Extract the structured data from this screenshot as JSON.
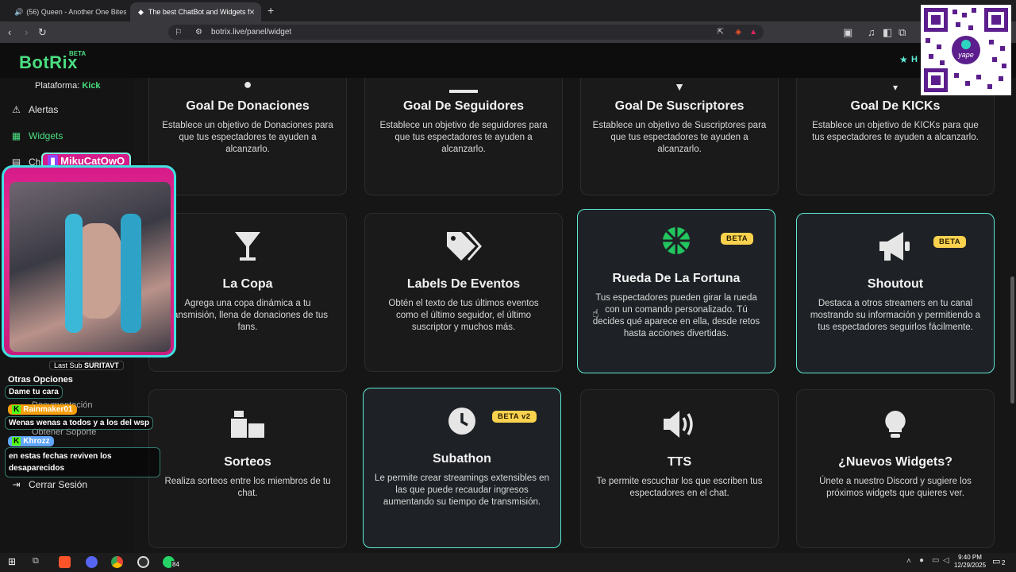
{
  "browser": {
    "tabs": [
      {
        "label": "(56) Queen - Another One Bites t"
      },
      {
        "label": "The best ChatBot and Widgets f"
      }
    ],
    "new_tab": "+",
    "url": "botrix.live/panel/widget"
  },
  "app": {
    "logo": "BotRix",
    "logo_badge": "BETA",
    "platform_label": "Plataforma:",
    "platform_value": "Kick",
    "header_right": "H"
  },
  "sidebar": {
    "items": [
      {
        "label": "Alertas"
      },
      {
        "label": "Widgets"
      },
      {
        "label": "Ch"
      }
    ],
    "other_options": "Otras Opciones",
    "doc_partial": "Documentación",
    "support": "Obtener Soporte",
    "logout": "Cerrar Sesión"
  },
  "cards": [
    {
      "title": "Goal De Donaciones",
      "desc": "Establece un objetivo de Donaciones para que tus espectadores te ayuden a alcanzarlo."
    },
    {
      "title": "Goal De Seguidores",
      "desc": "Establece un objetivo de seguidores para que tus espectadores te ayuden a alcanzarlo."
    },
    {
      "title": "Goal De Suscriptores",
      "desc": "Establece un objetivo de Suscriptores para que tus espectadores te ayuden a alcanzarlo."
    },
    {
      "title": "Goal De KICKs",
      "desc": "Establece un objetivo de KICKs para que tus espectadores te ayuden a alcanzarlo."
    },
    {
      "title": "La Copa",
      "desc": "Agrega una copa dinámica a tu transmisión, llena de donaciones de tus fans."
    },
    {
      "title": "Labels De Eventos",
      "desc": "Obtén el texto de tus últimos eventos como el último seguidor, el último suscriptor y muchos más."
    },
    {
      "title": "Rueda De La Fortuna",
      "desc": "Tus espectadores pueden girar la rueda con un comando personalizado. Tú decides qué aparece en ella, desde retos hasta acciones divertidas.",
      "badge": "BETA"
    },
    {
      "title": "Shoutout",
      "desc": "Destaca a otros streamers en tu canal mostrando su información y permitiendo a tus espectadores seguirlos fácilmente.",
      "badge": "BETA"
    },
    {
      "title": "Sorteos",
      "desc": "Realiza sorteos entre los miembros de tu chat."
    },
    {
      "title": "Subathon",
      "desc": "Le permite crear streamings extensibles en las que puede recaudar ingresos aumentando su tiempo de transmisión.",
      "badge": "BETA v2"
    },
    {
      "title": "TTS",
      "desc": "Te permite escuchar los que escriben tus espectadores en el chat."
    },
    {
      "title": "¿Nuevos Widgets?",
      "desc": "Únete a nuestro Discord y sugiere los próximos widgets que quieres ver."
    }
  ],
  "overlay": {
    "cam_name": "MikuCatOwO",
    "last_sub_label": "Last Sub",
    "last_sub_value": "SURITAVT",
    "chat": [
      {
        "user": "",
        "msg": "Dame tu cara"
      },
      {
        "user": "Rainmaker01",
        "msg": "Wenas wenas a todos y a los del wsp"
      },
      {
        "user": "Khrozz",
        "msg": "en estas fechas reviven los desaparecidos"
      }
    ]
  },
  "taskbar": {
    "time": "9:40 PM",
    "date": "12/29/2025",
    "whatsapp_count": "84",
    "notif_count": "2"
  },
  "colors": {
    "accent": "#4ade80",
    "highlight_border": "#5eead4",
    "badge": "#fbd24e"
  }
}
